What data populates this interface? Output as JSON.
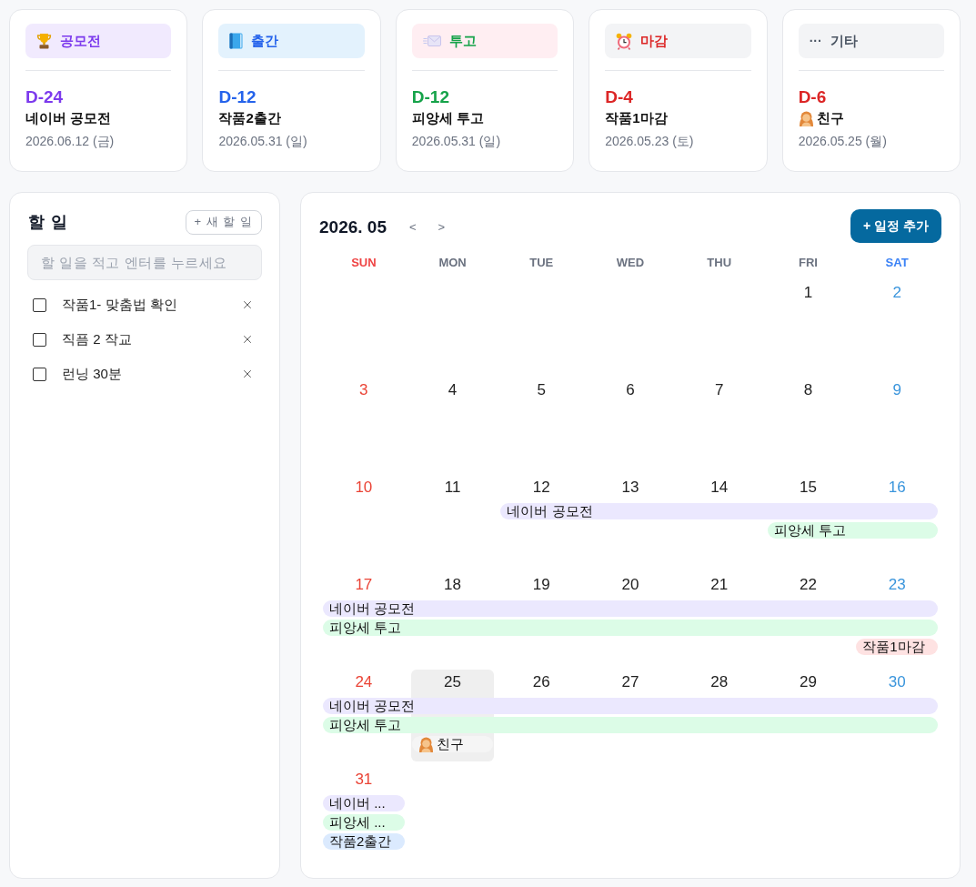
{
  "cards": [
    {
      "kind": "trophy",
      "tag": {
        "color": "#f1eafe",
        "label": {
          "text": "공모전",
          "color": "#7c3aed"
        }
      },
      "dday": {
        "text": "D-24",
        "color": "#7c3aed"
      },
      "title": {
        "text": "네이버 공모전",
        "avatar": false
      },
      "date": "2026.06.12 (금)"
    },
    {
      "kind": "book",
      "tag": {
        "color": "#e3f2fd",
        "label": {
          "text": "출간",
          "color": "#2563eb"
        }
      },
      "dday": {
        "text": "D-12",
        "color": "#2563eb"
      },
      "title": {
        "text": "작품2출간",
        "avatar": false
      },
      "date": "2026.05.31 (일)"
    },
    {
      "kind": "envelope",
      "tag": {
        "color": "#ffeef2",
        "label": {
          "text": "투고",
          "color": "#16a34a"
        }
      },
      "dday": {
        "text": "D-12",
        "color": "#16a34a"
      },
      "title": {
        "text": "피앙세 투고",
        "avatar": false
      },
      "date": "2026.05.31 (일)"
    },
    {
      "kind": "alarm",
      "tag": {
        "color": "#f3f4f6",
        "label": {
          "text": "마감",
          "color": "#dc2626"
        }
      },
      "dday": {
        "text": "D-4",
        "color": "#dc2626"
      },
      "title": {
        "text": "작품1마감",
        "avatar": false
      },
      "date": "2026.05.23 (토)"
    },
    {
      "kind": "other",
      "tag": {
        "color": "#f3f4f6",
        "symbol": "···",
        "label": {
          "text": "기타",
          "color": "#4b5563"
        }
      },
      "dday": {
        "text": "D-6",
        "color": "#dc2626"
      },
      "title": {
        "text": "친구",
        "avatar": true
      },
      "date": "2026.05.25 (월)"
    }
  ],
  "todo": {
    "title": "할 일",
    "new_button": "+ 새 할 일",
    "input": {
      "placeholder": "할 일을 적고 엔터를 누르세요"
    },
    "items": [
      {
        "text": "작품1- 맞춤법 확인",
        "checked": false
      },
      {
        "text": "직픔 2 작교",
        "checked": false
      },
      {
        "text": "런닝 30분",
        "checked": false
      }
    ]
  },
  "calendar": {
    "title": "2026. 05",
    "prev": "<",
    "next": ">",
    "add_button": "+ 일정 추가",
    "weekdays": [
      {
        "label": "SUN",
        "kind": "sun"
      },
      {
        "label": "MON",
        "kind": "weekday"
      },
      {
        "label": "TUE",
        "kind": "weekday"
      },
      {
        "label": "WED",
        "kind": "weekday"
      },
      {
        "label": "THU",
        "kind": "weekday"
      },
      {
        "label": "FRI",
        "kind": "weekday"
      },
      {
        "label": "SAT",
        "kind": "sat"
      }
    ],
    "weeks": [
      {
        "days": [
          {
            "day": "1",
            "today": false
          },
          {
            "day": "2",
            "today": false
          }
        ]
      },
      {
        "days": [
          {
            "day": "3",
            "today": false
          },
          {
            "day": "4",
            "today": false
          },
          {
            "day": "5",
            "today": false
          },
          {
            "day": "6",
            "today": false
          },
          {
            "day": "7",
            "today": false
          },
          {
            "day": "8",
            "today": false
          },
          {
            "day": "9",
            "today": false
          }
        ]
      },
      {
        "days": [
          {
            "day": "10",
            "today": false
          },
          {
            "day": "11",
            "today": false
          },
          {
            "day": "12",
            "today": false,
            "events": [
              {
                "title": "네이버 공모전",
                "color": "#ebe8fe",
                "avatar": false,
                "continues": true
              }
            ]
          },
          {
            "day": "13",
            "today": false
          },
          {
            "day": "14",
            "today": false
          },
          {
            "day": "15",
            "today": false,
            "events": [
              {
                "title": "피앙세 투고",
                "color": "#dcfce7",
                "avatar": false,
                "continues": true
              }
            ]
          },
          {
            "day": "16",
            "today": false
          }
        ]
      },
      {
        "days": [
          {
            "day": "17",
            "today": false,
            "events": [
              {
                "title": "네이버 공모전",
                "color": "#ebe8fe",
                "avatar": false,
                "continues": true
              },
              {
                "title": "피앙세 투고",
                "color": "#dcfce7",
                "avatar": false,
                "continues": true
              }
            ]
          },
          {
            "day": "18",
            "today": false
          },
          {
            "day": "19",
            "today": false
          },
          {
            "day": "20",
            "today": false
          },
          {
            "day": "21",
            "today": false
          },
          {
            "day": "22",
            "today": false
          },
          {
            "day": "23",
            "today": false,
            "events": [
              {
                "title": "작품1마감",
                "color": "#fee2e2",
                "avatar": false,
                "continues": false
              }
            ]
          }
        ]
      },
      {
        "days": [
          {
            "day": "24",
            "today": false,
            "events": [
              {
                "title": "네이버 공모전",
                "color": "#ebe8fe",
                "avatar": false,
                "continues": true
              },
              {
                "title": "피앙세 투고",
                "color": "#dcfce7",
                "avatar": false,
                "continues": true
              }
            ]
          },
          {
            "day": "25",
            "today": true,
            "events": [
              {
                "title": "친구",
                "color": "#f5f5f5",
                "avatar": true,
                "continues": false
              }
            ]
          },
          {
            "day": "26",
            "today": false
          },
          {
            "day": "27",
            "today": false
          },
          {
            "day": "28",
            "today": false
          },
          {
            "day": "29",
            "today": false
          },
          {
            "day": "30",
            "today": false
          }
        ]
      },
      {
        "days": [
          {
            "day": "31",
            "today": false,
            "events": [
              {
                "title": "네이버 ...",
                "color": "#ebe8fe",
                "avatar": false,
                "continues": false
              },
              {
                "title": "피앙세 ...",
                "color": "#dcfce7",
                "avatar": false,
                "continues": false
              },
              {
                "title": "작품2출간",
                "color": "#dbeafe",
                "avatar": false,
                "continues": false
              }
            ]
          }
        ]
      }
    ]
  }
}
